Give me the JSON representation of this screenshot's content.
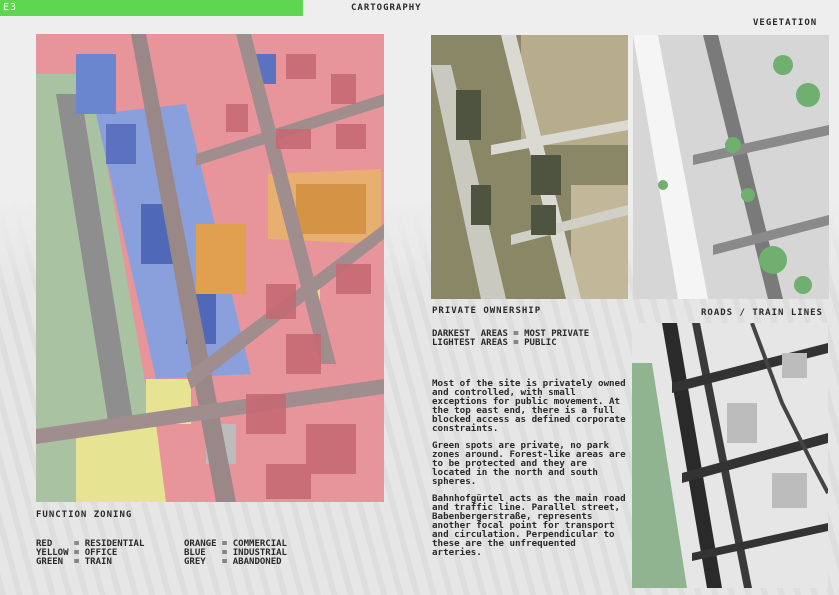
{
  "header": {
    "code": "E3",
    "title": "CARTOGRAPHY"
  },
  "labels": {
    "vegetation": "VEGETATION",
    "private_ownership": "PRIVATE OWNERSHIP",
    "roads": "ROADS / TRAIN LINES",
    "function_zoning": "FUNCTION ZONING"
  },
  "ownership_legend": {
    "line1": "DARKEST  AREAS = MOST PRIVATE",
    "line2": "LIGHTEST AREAS = PUBLIC"
  },
  "zoning_legend": {
    "red": "RED    = RESIDENTIAL",
    "yellow": "YELLOW = OFFICE",
    "green": "GREEN  = TRAIN",
    "orange": "ORANGE = COMMERCIAL",
    "blue": "BLUE   = INDUSTRIAL",
    "grey": "GREY   = ABANDONED"
  },
  "text": {
    "p1": "Most of the site is privately owned and controlled, with small exceptions for public movement. At the top east end, there is a full blocked access as defined corporate constraints.",
    "p2": "Green spots are private, no park zones around. Forest-like areas are to be protected and they are located in the north and south spheres.",
    "p3": "Bahnhofgürtel acts as the main road and traffic line. Parallel street, Babenbergerstraße, represents another focal point for transport and circulation. Perpendicular to these are the unfrequented arteries."
  },
  "colors": {
    "accent": "#5fd651",
    "residential": "#e8919a",
    "office": "#e6e08a",
    "train": "#a8c8a0",
    "commercial": "#e0a860",
    "industrial": "#7a98d8",
    "abandoned": "#9a9a9a"
  }
}
